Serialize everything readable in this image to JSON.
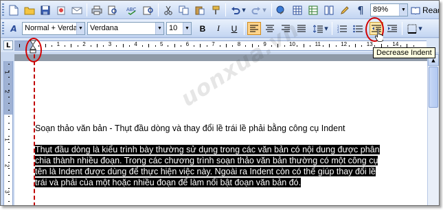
{
  "toolbar1": {
    "icons": [
      "new-document-icon",
      "open-icon",
      "save-icon",
      "permission-icon",
      "email-icon",
      "print-icon",
      "print-preview-icon",
      "spelling-icon",
      "research-icon",
      "cut-icon",
      "copy-icon",
      "paste-icon",
      "format-painter-icon",
      "undo-icon",
      "redo-icon",
      "hyperlink-icon",
      "tables-icon",
      "show-formatting-icon"
    ],
    "pilcrow": "¶",
    "zoom": "89%",
    "read_label": "Read"
  },
  "toolbar2": {
    "styles_icon": "A",
    "style_value": "Normal + Verda",
    "font_value": "Verdana",
    "size_value": "10",
    "bold": "B",
    "italic": "I",
    "underline": "U"
  },
  "ruler": {
    "numbers": [
      "1",
      "1",
      "2",
      "3",
      "4",
      "5",
      "6",
      "7",
      "8",
      "9",
      "10",
      "11",
      "12",
      "13",
      "14"
    ],
    "tab_selector": "L",
    "vertical_numbers": [
      "1",
      "2",
      "1",
      "2",
      "3"
    ]
  },
  "tooltip": "Decrease Indent",
  "document": {
    "heading": "Soạn thảo văn bản -  Thụt đầu dòng và thay đổi lề trái lề phải bằng công cụ Indent",
    "paragraph_lines": [
      "Thụt đầu dòng là kiểu trình bày thường sử dụng trong các văn bản có nội dung được phân",
      "chia thành nhiều đoạn. Trong các chương trình soạn thảo văn bản thường có một công cụ",
      "tên là Indent được dùng để thực hiện việc này. Ngoài ra Indent còn có thể giúp thay đổi lề",
      "trái và phải của một hoặc nhiều đoạn để làm nổi bật đoạn văn bản đó."
    ]
  },
  "watermark": "uonxua.vn",
  "colors": {
    "highlight_circle": "#d20000",
    "indent_line": "#c00000",
    "selection": "#000000"
  }
}
